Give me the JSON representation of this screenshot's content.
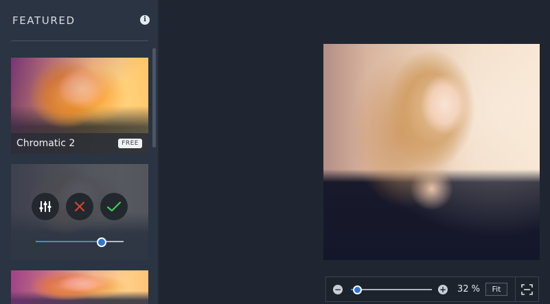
{
  "sidebar": {
    "title": "FEATURED",
    "cards": [
      {
        "label": "Chromatic 2",
        "badge": "FREE"
      },
      {
        "slider_value": 0.75
      },
      {}
    ]
  },
  "icons": {
    "info": "info-icon",
    "adjust": "sliders-icon",
    "cancel": "close-icon",
    "apply": "check-icon",
    "zoom_out": "minus-icon",
    "zoom_in": "plus-icon",
    "fullscreen": "fullscreen-icon"
  },
  "zoom": {
    "value_text": "32 %",
    "slider_value": 0.08,
    "fit_label": "Fit",
    "minus": "−",
    "plus": "+"
  },
  "colors": {
    "accent": "#2f75d2",
    "cancel": "#e0442c",
    "apply": "#3bd45a",
    "background": "#1f2631",
    "sidebar": "#2b3442"
  }
}
